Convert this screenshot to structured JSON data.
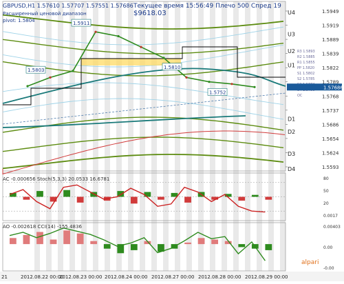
{
  "header": {
    "symbol_line": "GBPUSD,H1  1.57610 1.57707 1.57551 1.57686",
    "note_line1": "Расширенный ценовой диапазон",
    "note_line2": "pivot: 1.5804",
    "server_line": "Текущее время 15:56:49 Плечо 500 Спред 19",
    "balance": "$9618.03"
  },
  "chart_data": [
    {
      "type": "line",
      "panel": "main",
      "title": "GBPUSD,H1",
      "x": [
        "2012.08.22 00:00",
        "2012.08.22 12:00",
        "2012.08.23 00:00",
        "2012.08.23 12:00",
        "2012.08.24 00:00",
        "2012.08.24 12:00",
        "2012.08.27 00:00",
        "2012.08.27 12:00",
        "2012.08.28 00:00",
        "2012.08.28 12:00",
        "2012.08.29 00:00"
      ],
      "x_ticks": [
        "21",
        "2012.08.22 00:00",
        "2012.08.23 00:00",
        "2012.08.24 00:00",
        "2012.08.27 00:00",
        "2012.08.28 00:00",
        "2012.08.29 00:00"
      ],
      "y_ticks": [
        "1.5949",
        "1.5919",
        "1.5889",
        "1.5839",
        "1.5822",
        "1.5789",
        "1.5768",
        "1.5737",
        "1.5686",
        "1.5654",
        "1.5624",
        "1.5593"
      ],
      "ylim": [
        1.5575,
        1.5965
      ],
      "price": [
        1.577,
        1.579,
        1.5805,
        1.5895,
        1.5885,
        1.586,
        1.5835,
        1.579,
        1.578,
        1.5775,
        1.5768
      ],
      "annotations": [
        {
          "label": "1.5911",
          "x": "2012.08.23 00:00",
          "y": 1.5911
        },
        {
          "label": "1.5810",
          "x": "2012.08.27 00:00",
          "y": 1.581
        },
        {
          "label": "1.5752",
          "x": "2012.08.28 00:00",
          "y": 1.5752
        },
        {
          "label": "1.5803",
          "x": "2012.08.22 00:00",
          "y": 1.5803
        }
      ],
      "upper_levels": [
        {
          "label": "U4",
          "y": 1.594
        },
        {
          "label": "U3",
          "y": 1.589
        },
        {
          "label": "U2",
          "y": 1.5851
        },
        {
          "label": "U1",
          "y": 1.5818
        }
      ],
      "lower_levels": [
        {
          "label": "L3",
          "y": 1.5768
        },
        {
          "label": "D1",
          "y": 1.5695
        },
        {
          "label": "D2",
          "y": 1.5665
        },
        {
          "label": "D3",
          "y": 1.5615
        },
        {
          "label": "D4",
          "y": 1.558
        }
      ],
      "right_labels": [
        "R3 1.5893",
        "R2 1.5885",
        "R1 1.5855",
        "PP 1.5820",
        "S1 1.5802",
        "S2 1.5785",
        "S3 1.5774",
        "S4 1.5756",
        "OC"
      ],
      "current_price": "1.57686",
      "colors": {
        "price": "#2e8b1e",
        "bands": "#5d8c11",
        "ma": "#1a7a7a",
        "ma_slow": "#d13b3b",
        "box": "#000000",
        "highlight": "#ffd85a"
      }
    },
    {
      "type": "line",
      "panel": "ac_stoch",
      "title": "AC -0.000656  Stoch(5,3,3) 20.0533 16.6781",
      "y_ticks": [
        "80",
        "50",
        "20",
        "0.0017"
      ],
      "ylim": [
        0,
        100
      ],
      "series": [
        {
          "name": "Stoch(5,3,3)",
          "values": [
            55,
            65,
            40,
            25,
            70,
            75,
            60,
            45,
            50,
            68,
            55,
            30,
            35,
            70,
            60,
            40,
            55,
            30,
            20,
            18
          ]
        }
      ],
      "bars": [
        0.4,
        -0.3,
        0.6,
        -0.5,
        0.7,
        -0.6,
        0.5,
        -0.4,
        0.6,
        -0.7,
        0.5,
        -0.3,
        0.4,
        -0.6,
        0.5,
        -0.3,
        0.3,
        -0.4,
        0.2,
        -0.3
      ]
    },
    {
      "type": "line",
      "panel": "ao_cci",
      "title": "AO -0.002618  CCI(14) -155.4836",
      "y_ticks": [
        "0.00403",
        "0.00",
        "-0.00"
      ],
      "ylim": [
        -250,
        200
      ],
      "series": [
        {
          "name": "CCI(14)",
          "values": [
            80,
            110,
            60,
            100,
            150,
            120,
            90,
            40,
            -20,
            10,
            60,
            -80,
            -40,
            30,
            110,
            50,
            70,
            -90,
            20,
            -155
          ]
        }
      ],
      "bars": [
        0.4,
        0.6,
        0.8,
        0.3,
        0.9,
        0.7,
        0.2,
        -0.3,
        -0.6,
        -0.4,
        0.2,
        -0.5,
        -0.3,
        0.1,
        0.4,
        0.3,
        0.2,
        -0.2,
        -0.3,
        -0.4
      ],
      "logo": "alpari"
    }
  ]
}
